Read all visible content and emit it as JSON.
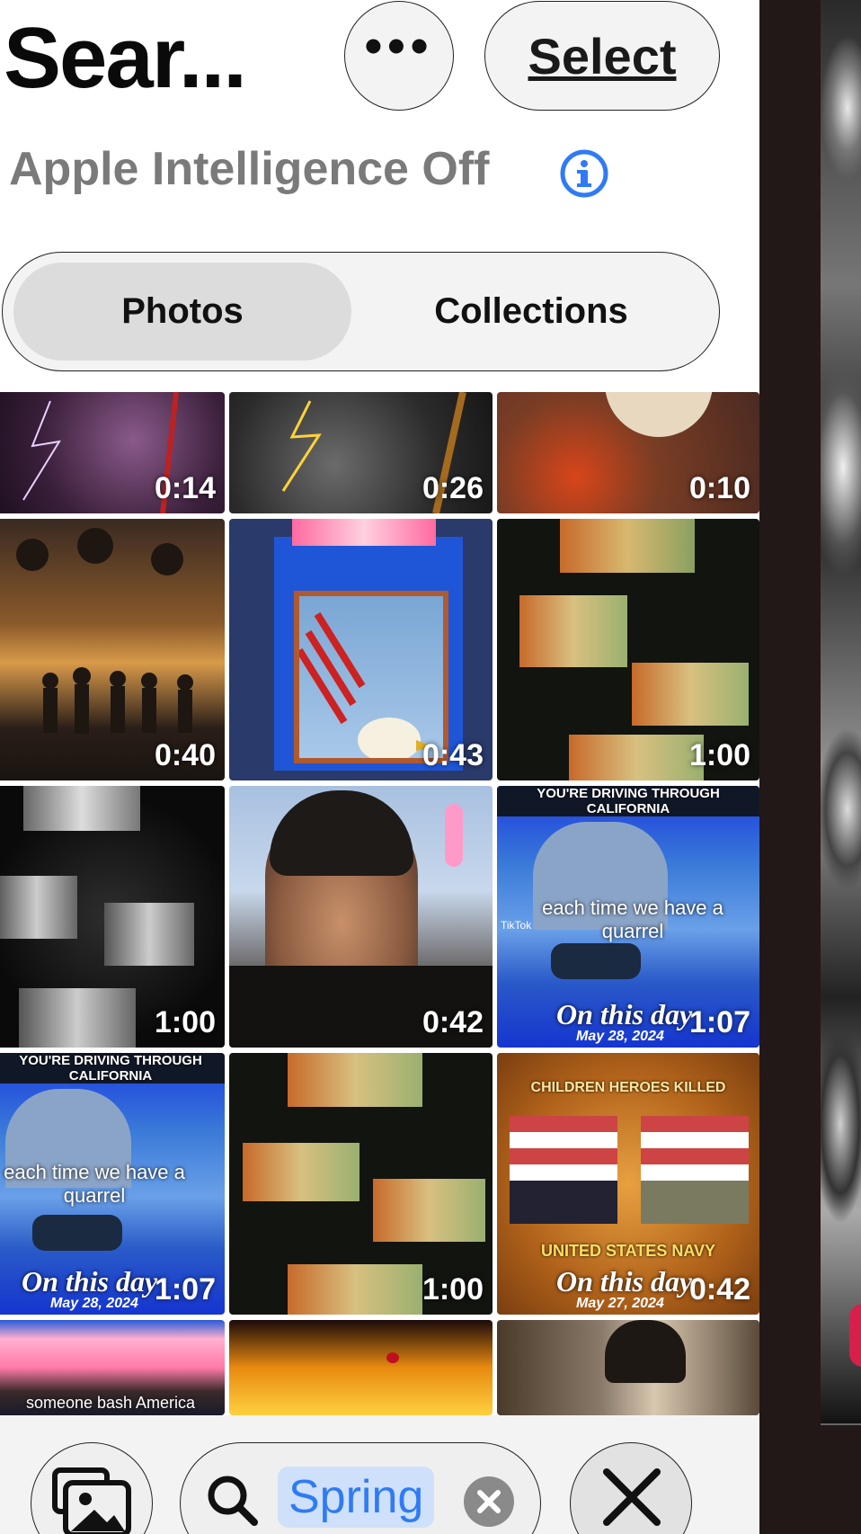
{
  "header": {
    "title": "Sear...",
    "more_label": "•••",
    "select_label": "Select",
    "intelligence_status": "Apple Intelligence Off"
  },
  "segmented": {
    "tabs": [
      {
        "label": "Photos",
        "selected": true
      },
      {
        "label": "Collections",
        "selected": false
      }
    ]
  },
  "grid": {
    "tiles": [
      {
        "duration": "0:14"
      },
      {
        "duration": "0:26"
      },
      {
        "duration": "0:10"
      },
      {
        "duration": "0:40"
      },
      {
        "duration": "0:43"
      },
      {
        "duration": "1:00"
      },
      {
        "duration": "1:00"
      },
      {
        "duration": "0:42"
      },
      {
        "duration": "1:07",
        "banner": "YOU'RE DRIVING THROUGH CALIFORNIA",
        "caption": "each time we have a quarrel",
        "overlay": "On this day",
        "date": "May 28, 2024",
        "source": "TikTok"
      },
      {
        "duration": "1:07",
        "banner": "YOU'RE DRIVING THROUGH CALIFORNIA",
        "caption": "each time we have a quarrel",
        "overlay": "On this day",
        "date": "May 28, 2024"
      },
      {
        "duration": "1:00"
      },
      {
        "duration": "0:42",
        "banner": "CHILDREN HEROES KILLED",
        "caption": "UNITED STATES NAVY",
        "overlay": "On this day",
        "date": "May 27, 2024"
      },
      {
        "caption": "someone bash America"
      },
      {},
      {}
    ]
  },
  "search": {
    "token": "Spring"
  },
  "colors": {
    "accent": "#2f7bf5",
    "token_bg": "#cfe0fb"
  }
}
